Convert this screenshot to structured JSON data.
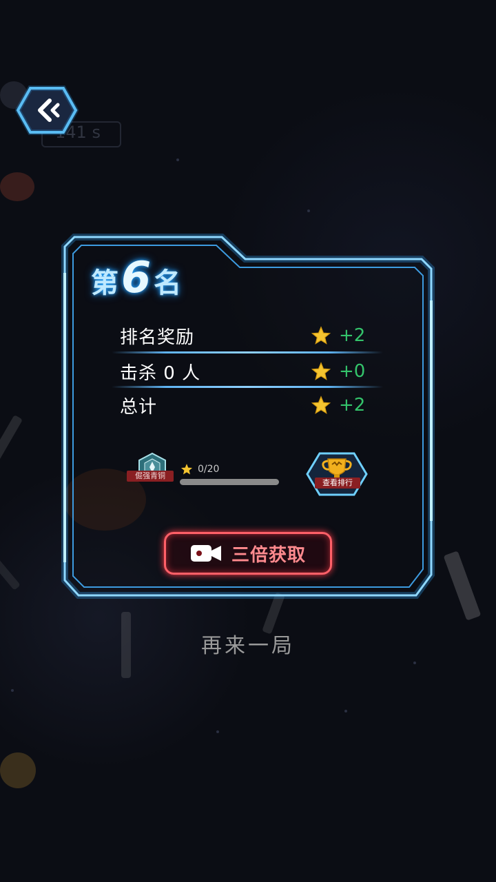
{
  "header": {
    "back_icon": "double-chevron-left-icon",
    "timer": "141 s"
  },
  "result": {
    "rank_prefix": "第",
    "rank_number": "6",
    "rank_suffix": "名",
    "rows": [
      {
        "label": "排名奖励",
        "icon": "star-icon",
        "amount": "+2"
      },
      {
        "label": "击杀 0 人",
        "icon": "star-icon",
        "amount": "+0"
      },
      {
        "label": "总计",
        "icon": "star-icon",
        "amount": "+2"
      }
    ]
  },
  "tier": {
    "badge_label": "倔强青铜",
    "progress_text": "0/20",
    "progress_fraction": 0
  },
  "leaderboard": {
    "label": "查看排行",
    "icon": "trophy-icon"
  },
  "actions": {
    "triple_label": "三倍获取",
    "triple_icon": "video-camera-icon",
    "play_again_label": "再来一局"
  },
  "colors": {
    "accent_blue": "#5fb3f2",
    "reward_green": "#34c36b",
    "button_red": "#ff6068",
    "gold": "#e6c54a"
  }
}
